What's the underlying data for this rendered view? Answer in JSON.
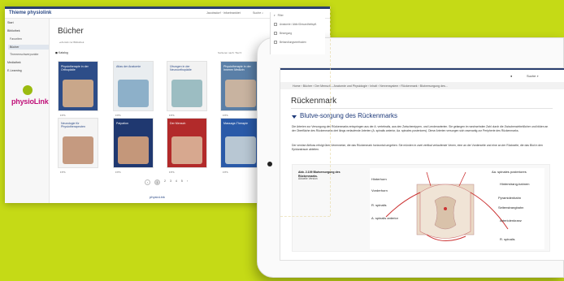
{
  "screen1": {
    "brand": "Thieme physiolink",
    "user_label": "Jacobsdorf · Infoebranktet",
    "search_label": "Suche",
    "filter": {
      "title": "Filter",
      "items": [
        "Anatomie / Aktiv/Gesundheitspfl.",
        "Bewegung",
        "Behandlungsmethoden"
      ]
    },
    "sidebar": {
      "items": [
        {
          "label": "Start",
          "type": "top"
        },
        {
          "label": "Bibliothek",
          "type": "top"
        },
        {
          "label": "Favoriten",
          "type": "sub"
        },
        {
          "label": "Bücher",
          "type": "active"
        },
        {
          "label": "Themenschwerpunkte",
          "type": "sub"
        },
        {
          "label": "Mediathek",
          "type": "top"
        },
        {
          "label": "E-Learning",
          "type": "top"
        }
      ],
      "logo_text": "physioLink"
    },
    "page_title": "Bücher",
    "page_sub": "◂ Zurück zur Bibliothek",
    "grid_title": "◼ Katalog",
    "sort_label": "Sortieren nach: Titel ▾",
    "books": [
      {
        "title": "Physiotherapie in der Orthopädie",
        "tag": "FITS",
        "cover": "#2d4d88",
        "img": "#c9a78a"
      },
      {
        "title": "Atlas der Anatomie",
        "tag": "FITS",
        "cover": "#e9edf0",
        "img": "#8db0c9"
      },
      {
        "title": "Übungen in der Neuroorthopädie",
        "tag": "FITS",
        "cover": "#f2f2f2",
        "img": "#9cbdc2"
      },
      {
        "title": "Physiotherapie in der Inneren Medizin",
        "tag": "FITS",
        "cover": "#5a7fa7",
        "img": "#c8b3a0"
      },
      {
        "title": "Neurologie für Physiotherapeuten",
        "tag": "FITS",
        "cover": "#f4f4f4",
        "img": "#c59a80"
      },
      {
        "title": "Palpation",
        "tag": "FITS",
        "cover": "#1f3870",
        "img": "#c4977a"
      },
      {
        "title": "Der Mensch",
        "tag": "FITS",
        "cover": "#b22a2a",
        "img": "#d7a88f"
      },
      {
        "title": "Massage-Therapie",
        "tag": "FITS",
        "cover": "#2a5aa8",
        "img": "#b8c7d3"
      }
    ],
    "pager": [
      "‹",
      "1",
      "2",
      "3",
      "4",
      "5",
      "›"
    ],
    "footer_brand": "physioLink"
  },
  "screen2": {
    "user_icon": "user-icon",
    "search_label": "Suche",
    "breadcrumbs": "Home  ›  Bücher  ›  Der Mensch  –  Anatomie und Physiologie  ›  Inhalt  ›  Nervensystem  ›  Rückenmark  ›  Blutversorgung des...",
    "title": "Rückenmark",
    "section_heading": "Blutve-sorgung des Rückenmarks",
    "para1": "Die Arterien zur Versorgung des Rückenmarks entspringen aus der A. vertebralis, aus den Zwischenrippen- und Lendenarterien. Sie gelangen im wechselnden Zahl durch die Zwischenwirbellöcher und bilden an der Oberfläche des Rückenmarks drei längs verlaufende Arterien (A. spinalis anterior, Aa. spinales posteriores). Diese Arterien versorgen sich rasenartig zur Peripherie des Rückenmarks.",
    "para2": "Der venöse Abfluss erfolgt über Venennetze, die das Rückenmark horizontal umgeben. Sie münden in zwei vertikal verlaufende Venen, eine an der Vorderseite und eine an der Rückseite, die das Blut in den Epiduralraum ableiten.",
    "figure": {
      "label": "Abb. 2.109 Blutversorgung des Rückenmarks.",
      "sub": "Aktuelle Version",
      "labels_left": [
        "Hinterhorn",
        "Vorderhorn",
        "R. spinalis",
        "A. spinalis anterior"
      ],
      "labels_right": [
        "Aa. spinales posteriores",
        "Hinterstrang-bahnen",
        "Pyramidenbahn",
        "Seitenstrangbahn",
        "Arteriolenkranz",
        "R. spinalis"
      ]
    }
  }
}
